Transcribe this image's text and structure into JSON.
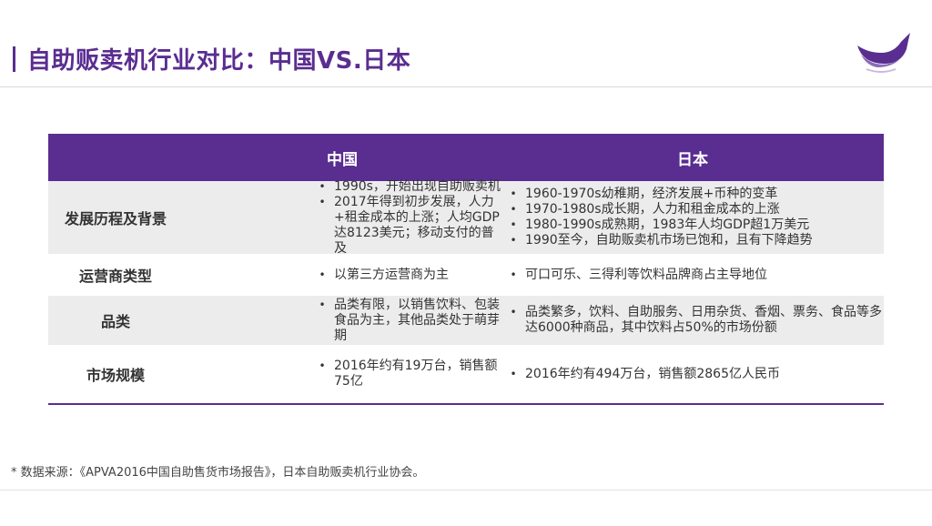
{
  "header": {
    "title": "自助贩卖机行业对比：中国VS.日本",
    "logo_icon": "whale-logo-icon",
    "accent": "#5a2d91"
  },
  "table": {
    "columns": [
      "",
      "中国",
      "日本"
    ],
    "rows": [
      {
        "label": "发展历程及背景",
        "china": [
          "1990s，开始出现自助贩卖机",
          "2017年得到初步发展，人力+租金成本的上涨；人均GDP达8123美元；移动支付的普及"
        ],
        "japan": [
          "1960-1970s幼稚期，经济发展+币种的变革",
          "1970-1980s成长期，人力和租金成本的上涨",
          "1980-1990s成熟期，1983年人均GDP超1万美元",
          "1990至今，自助贩卖机市场已饱和，且有下降趋势"
        ]
      },
      {
        "label": "运营商类型",
        "china": [
          "以第三方运营商为主"
        ],
        "japan": [
          "可口可乐、三得利等饮料品牌商占主导地位"
        ]
      },
      {
        "label": "品类",
        "china": [
          "品类有限，以销售饮料、包装食品为主，其他品类处于萌芽期"
        ],
        "japan": [
          "品类繁多，饮料、自助服务、日用杂货、香烟、票务、食品等多达6000种商品，其中饮料占50%的市场份额"
        ]
      },
      {
        "label": "市场规模",
        "china": [
          "2016年约有19万台，销售额75亿"
        ],
        "japan": [
          "2016年约有494万台，销售额2865亿人民币"
        ]
      }
    ]
  },
  "footer": {
    "source": "* 数据来源：《APVA2016中国自助售货市场报告》，日本自助贩卖机行业协会。"
  }
}
